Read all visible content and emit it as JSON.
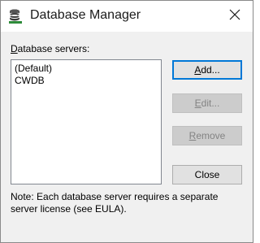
{
  "window": {
    "title": "Database Manager",
    "icon": "database-icon"
  },
  "servers_label": {
    "prefix": "D",
    "rest": "atabase servers:"
  },
  "servers": [
    {
      "name": "(Default)"
    },
    {
      "name": "CWDB"
    }
  ],
  "buttons": {
    "add": {
      "mnemonic": "A",
      "rest": "dd..."
    },
    "edit": {
      "mnemonic": "E",
      "rest": "dit..."
    },
    "remove": {
      "mnemonic": "R",
      "rest": "emove"
    },
    "close": {
      "label": "Close"
    }
  },
  "note": {
    "line1": "Note: Each database server requires a separate",
    "line2": "server license (see EULA)."
  },
  "colors": {
    "accent": "#0078d7",
    "window_bg": "#f0f0f0",
    "icon_green": "#2e8b3a"
  }
}
